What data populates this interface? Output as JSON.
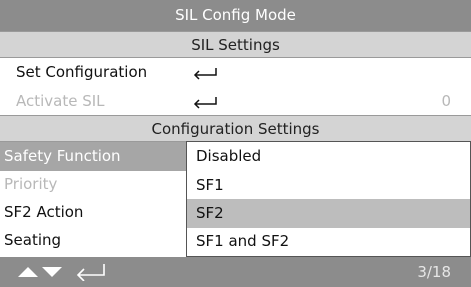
{
  "title": "SIL Config Mode",
  "sil_settings": {
    "header": "SIL Settings",
    "items": [
      {
        "label": "Set Configuration",
        "value": ""
      },
      {
        "label": "Activate SIL",
        "value": "0"
      }
    ]
  },
  "config_settings": {
    "header": "Configuration Settings",
    "items": [
      {
        "label": "Safety Function"
      },
      {
        "label": "Priority"
      },
      {
        "label": "SF2 Action"
      },
      {
        "label": "Seating"
      }
    ]
  },
  "dropdown": {
    "options": [
      "Disabled",
      "SF1",
      "SF2",
      "SF1 and SF2"
    ],
    "highlighted": "SF2"
  },
  "footer": {
    "page": "3/18"
  },
  "icons": {
    "enter": "enter-icon",
    "up": "up-arrow-icon",
    "down": "down-arrow-icon"
  },
  "colors": {
    "title_bar": "#8c8c8c",
    "selection": "#a6a6a6",
    "highlight": "#bdbdbd",
    "section_header": "#d4d4d4"
  }
}
